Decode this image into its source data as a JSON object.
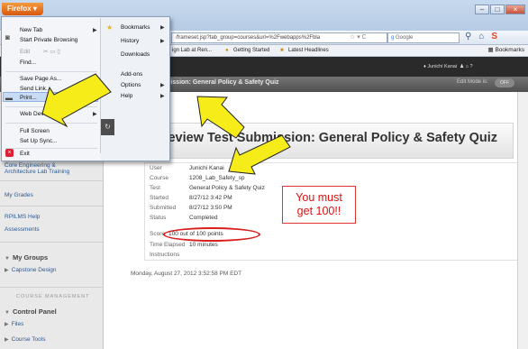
{
  "firefox": {
    "button_label": "Firefox",
    "url": "/frameset.jsp?tab_group=courses&url=%2Fwebapps%2Fbla",
    "search_placeholder": "Google",
    "bookmarks_bar": [
      "ign Lab at Ren...",
      "Getting Started",
      "Latest Headlines"
    ],
    "bookmarks_right": "Bookmarks"
  },
  "menu": {
    "left": [
      {
        "label": "New Tab",
        "arrow": true
      },
      {
        "label": "Start Private Browsing"
      },
      {
        "label": "Edit",
        "disabled": true
      },
      {
        "label": "Find..."
      },
      {
        "label": "Save Page As..."
      },
      {
        "label": "Send Link..."
      },
      {
        "label": "Print...",
        "arrow": true,
        "highlighted": true
      },
      {
        "label": "Web Developer",
        "arrow": true
      },
      {
        "label": "Full Screen"
      },
      {
        "label": "Set Up Sync..."
      },
      {
        "label": "Exit"
      }
    ],
    "right": [
      {
        "label": "Bookmarks",
        "arrow": true
      },
      {
        "label": "History",
        "arrow": true
      },
      {
        "label": "Downloads"
      },
      {
        "label": "Add-ons"
      },
      {
        "label": "Options",
        "arrow": true
      },
      {
        "label": "Help",
        "arrow": true
      }
    ]
  },
  "bb": {
    "user": "Junichi Kanai",
    "breadcrumb": "Review Test Submission: General Policy & Safety Quiz",
    "edit_mode": "Edit Mode is:",
    "edit_toggle": "OFF",
    "page_title": "Review Test Submission: General Policy & Safety Quiz",
    "footer_date": "Monday, August 27, 2012 3:52:58 PM EDT"
  },
  "sidebar": {
    "course_links": [
      "Core Engineering &",
      "Architecture Lab Training",
      "My Grades",
      "RPILMS Help",
      "Assessments"
    ],
    "my_groups": "My Groups",
    "group_item": "Capstone Design",
    "course_management": "COURSE MANAGEMENT",
    "control_panel": "Control Panel",
    "files": "Files",
    "course_tools": "Course Tools"
  },
  "submission": [
    {
      "label": "User",
      "value": "Junichi Kanai"
    },
    {
      "label": "Course",
      "value": "1208_Lab_Safety_sp"
    },
    {
      "label": "Test",
      "value": "General Policy & Safety Quiz"
    },
    {
      "label": "Started",
      "value": "8/27/12 3:42 PM"
    },
    {
      "label": "Submitted",
      "value": "8/27/12 3:50 PM"
    },
    {
      "label": "Status",
      "value": "Completed"
    },
    {
      "label": "Score",
      "value": "100 out of 100 points"
    },
    {
      "label": "Time Elapsed",
      "value": "10 minutes"
    },
    {
      "label": "Instructions",
      "value": ""
    }
  ],
  "callout": {
    "line1": "You must",
    "line2": "get 100!!"
  },
  "colors": {
    "arrow_fill": "#f5ec1a",
    "callout_red": "#e01010",
    "firefox_orange": "#e8731f"
  }
}
